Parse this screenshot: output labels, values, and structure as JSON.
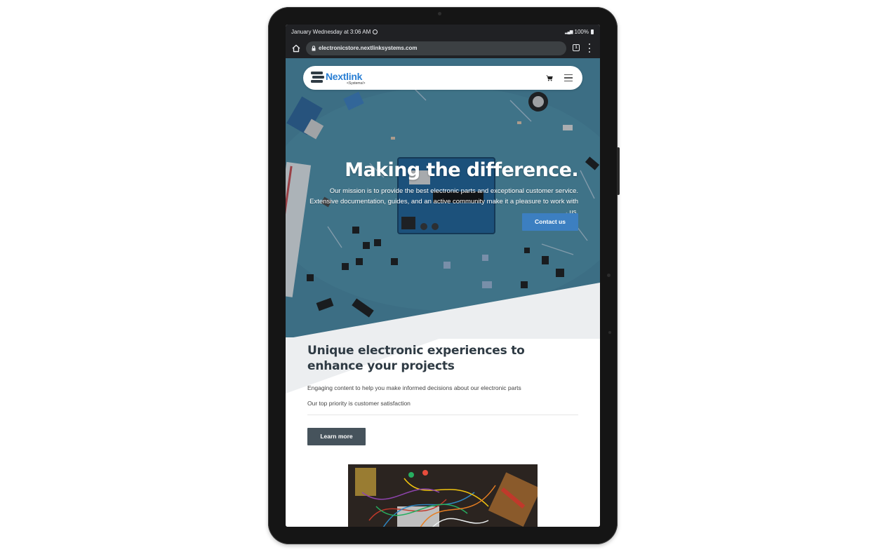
{
  "status_bar": {
    "datetime": "January Wednesday at 3:06 AM",
    "battery": "100%"
  },
  "browser": {
    "url": "electronicstore.nextlinksystems.com",
    "tab_count": "1"
  },
  "nav": {
    "logo_name": "Nextlink",
    "logo_sub": "<Systems/>"
  },
  "hero": {
    "title": "Making the difference.",
    "text": "Our mission is to provide the best electronic parts and exceptional customer service. Extensive documentation, guides, and an active community make it a pleasure to work with us.",
    "cta_label": "Contact us"
  },
  "section": {
    "title": "Unique electronic experiences to enhance your projects",
    "paragraph_1": "Engaging content to help you make informed decisions about our electronic parts",
    "paragraph_2": "Our top priority is customer satisfaction",
    "button_label": "Learn more"
  },
  "colors": {
    "hero_bg": "#467f96",
    "brand_blue": "#2a7fd4",
    "contact_button": "#3c7fc1",
    "learn_button": "#46535c",
    "wedge_gray": "#eceef0"
  }
}
